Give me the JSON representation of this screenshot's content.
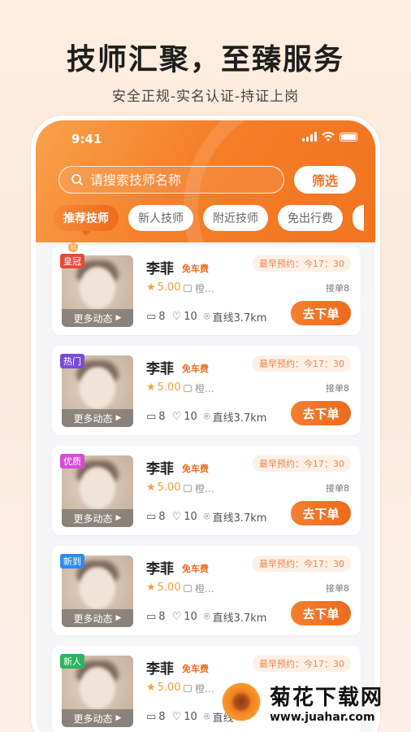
{
  "promo": {
    "title": "技师汇聚，至臻服务",
    "subtitle": "安全正规-实名认证-持证上岗"
  },
  "status_bar": {
    "time": "9:41"
  },
  "search": {
    "placeholder": "请搜索技师名称",
    "filter_label": "筛选"
  },
  "tabs": [
    {
      "label": "推荐技师",
      "active": true
    },
    {
      "label": "新人技师",
      "active": false
    },
    {
      "label": "附近技师",
      "active": false
    },
    {
      "label": "免出行费",
      "active": false
    }
  ],
  "cards": [
    {
      "badge": "皇冠",
      "badge_color": "#e84a3a",
      "name": "李菲",
      "fee_tag": "免车费",
      "earliest": "最早预约：今17：30",
      "rating": "5.00",
      "shop": "橙...",
      "orders": "接单8",
      "comments": "8",
      "likes": "10",
      "distance": "直线3.7km",
      "more": "更多动态",
      "button": "去下单"
    },
    {
      "badge": "热门",
      "badge_color": "#7b4bd8",
      "name": "李菲",
      "fee_tag": "免车费",
      "earliest": "最早预约：今17：30",
      "rating": "5.00",
      "shop": "橙...",
      "orders": "接单8",
      "comments": "8",
      "likes": "10",
      "distance": "直线3.7km",
      "more": "更多动态",
      "button": "去下单"
    },
    {
      "badge": "优质",
      "badge_color": "#d84bd6",
      "name": "李菲",
      "fee_tag": "免车费",
      "earliest": "最早预约：今17：30",
      "rating": "5.00",
      "shop": "橙...",
      "orders": "接单8",
      "comments": "8",
      "likes": "10",
      "distance": "直线3.7km",
      "more": "更多动态",
      "button": "去下单"
    },
    {
      "badge": "新到",
      "badge_color": "#2f8be8",
      "name": "李菲",
      "fee_tag": "免车费",
      "earliest": "最早预约：今17：30",
      "rating": "5.00",
      "shop": "橙...",
      "orders": "接单8",
      "comments": "8",
      "likes": "10",
      "distance": "直线3.7km",
      "more": "更多动态",
      "button": "去下单"
    },
    {
      "badge": "新人",
      "badge_color": "#2bb463",
      "name": "李菲",
      "fee_tag": "免车费",
      "earliest": "最早预约：今17：30",
      "rating": "5.00",
      "shop": "橙...",
      "orders": "",
      "comments": "8",
      "likes": "10",
      "distance": "直线",
      "more": "更多动态",
      "button": ""
    }
  ],
  "watermark": {
    "brand": "菊花下载网",
    "url": "www.juahar.com"
  }
}
